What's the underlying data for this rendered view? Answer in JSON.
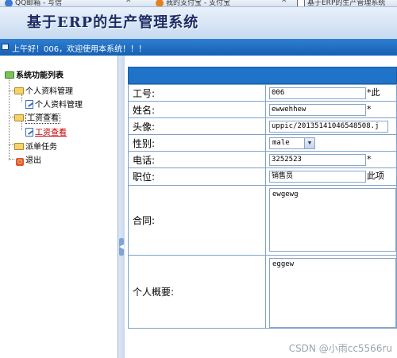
{
  "browser": {
    "tabs": [
      {
        "label": "QQ邮箱 - 写信",
        "icon": "mail-icon",
        "color": "#3a7bd5"
      },
      {
        "label": "我的支付宝 - 支付宝",
        "icon": "alipay-icon",
        "color": "#e67e22"
      },
      {
        "label": "基于ERP的生产管理系统",
        "icon": "page-icon",
        "color": "#ffffff"
      }
    ]
  },
  "header": {
    "title": "基于ERP的生产管理系统",
    "welcome": "上午好！006，欢迎使用本系统！！！"
  },
  "sidebar": {
    "root": "系统功能列表",
    "items": [
      {
        "label": "个人资料管理",
        "icon": "folder-icon"
      },
      {
        "label": "个人资料管理",
        "icon": "document-edit-icon"
      },
      {
        "label": "工资查看",
        "icon": "folder-icon"
      },
      {
        "label": "工资查看",
        "icon": "document-edit-icon"
      },
      {
        "label": "派单任务",
        "icon": "folder-icon"
      },
      {
        "label": "退出",
        "icon": "exit-icon"
      }
    ]
  },
  "form": {
    "fields": [
      {
        "label": "工号:",
        "value": "006",
        "suffix": "*此"
      },
      {
        "label": "姓名:",
        "value": "ewwehhew",
        "suffix": "*"
      },
      {
        "label": "头像:",
        "value": "uppic/20135141046548508.j",
        "suffix": ""
      },
      {
        "label": "性别:",
        "value": "male",
        "suffix": ""
      },
      {
        "label": "电话:",
        "value": "3252523",
        "suffix": "*"
      },
      {
        "label": "职位:",
        "value": "销售员",
        "suffix": "此项"
      },
      {
        "label": "合同:",
        "value": "ewgewg",
        "suffix": ""
      },
      {
        "label": "个人概要:",
        "value": "eggew",
        "suffix": ""
      }
    ]
  },
  "watermark": "CSDN @小雨cc5566ru",
  "colors": {
    "accent": "#1f73c9",
    "selected": "#c00000",
    "title": "#1d2c63"
  }
}
